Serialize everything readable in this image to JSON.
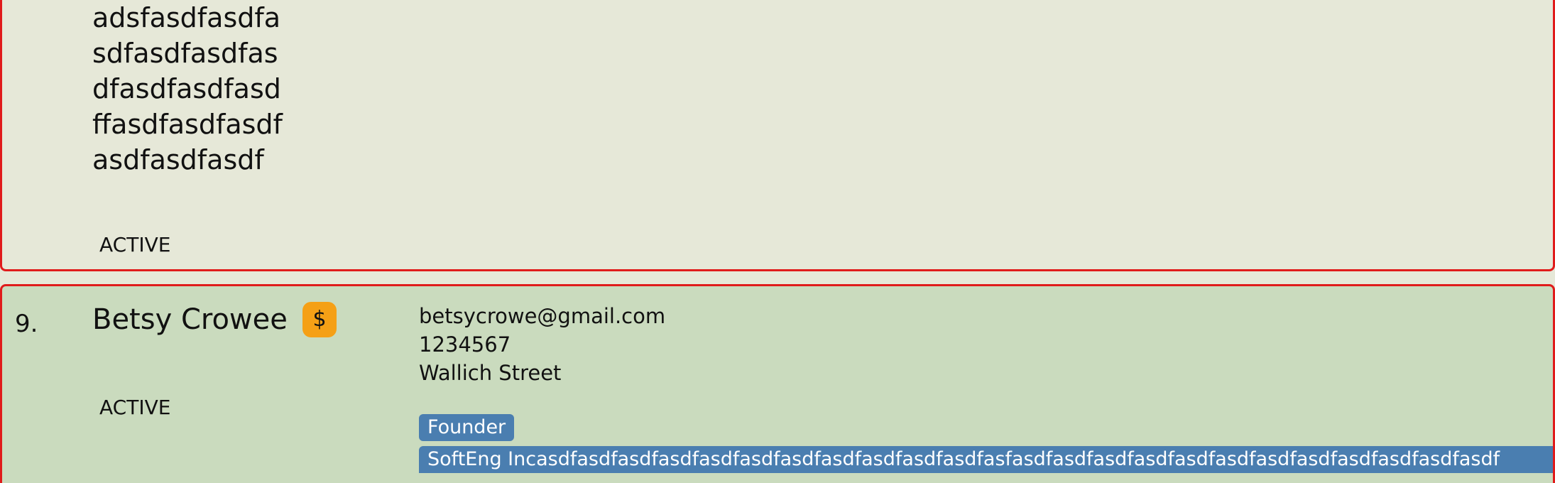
{
  "previous_card": {
    "name_lines": [
      "adsfasdfasdfa",
      "sdfasdfasdfas",
      "dfasdfasdfasd",
      "ffasdfasdfasdf",
      "asdfasdfasdf"
    ],
    "status": "ACTIVE"
  },
  "person_card": {
    "index": "9.",
    "name": "Betsy Crowee",
    "badge_symbol": "$",
    "email": "betsycrowe@gmail.com",
    "phone": "1234567",
    "address": "Wallich Street",
    "status": "ACTIVE",
    "tags": [
      "Founder",
      "SoftEng Incasdfasdfasdfasdfasdfasdfasdfasdfasdfasdfasdfasfasdfasdfasdfasdfasdfasdfasdfasdfasdfasdfasdfasdf"
    ]
  },
  "colors": {
    "card_top_bg": "#e6e8d8",
    "card_bottom_bg": "#cadbbe",
    "selected_border": "#e01b1b",
    "badge_bg": "#f5a016",
    "tag_bg": "#4a7eb0"
  },
  "icons": {
    "badge": "dollar-icon"
  }
}
